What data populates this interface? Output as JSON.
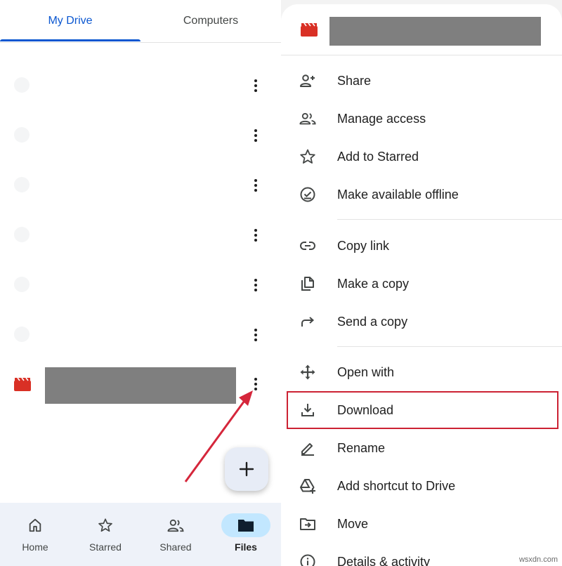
{
  "tabs": [
    {
      "label": "My Drive",
      "active": true
    },
    {
      "label": "Computers",
      "active": false
    }
  ],
  "file_list": {
    "highlighted_file_icon": "video-file-icon"
  },
  "bottom_nav": [
    {
      "label": "Home",
      "icon": "home-icon",
      "active": false
    },
    {
      "label": "Starred",
      "icon": "star-icon",
      "active": false
    },
    {
      "label": "Shared",
      "icon": "people-icon",
      "active": false
    },
    {
      "label": "Files",
      "icon": "folder-icon",
      "active": true
    }
  ],
  "fab": {
    "icon": "plus-icon"
  },
  "sheet": {
    "header_icon": "video-file-icon",
    "groups": [
      [
        {
          "label": "Share",
          "icon": "person-add-icon"
        },
        {
          "label": "Manage access",
          "icon": "people-icon"
        },
        {
          "label": "Add to Starred",
          "icon": "star-icon"
        },
        {
          "label": "Make available offline",
          "icon": "offline-check-icon"
        }
      ],
      [
        {
          "label": "Copy link",
          "icon": "link-icon"
        },
        {
          "label": "Make a copy",
          "icon": "copy-icon"
        },
        {
          "label": "Send a copy",
          "icon": "forward-icon"
        }
      ],
      [
        {
          "label": "Open with",
          "icon": "open-with-icon"
        },
        {
          "label": "Download",
          "icon": "download-icon",
          "highlighted": true
        },
        {
          "label": "Rename",
          "icon": "pencil-icon"
        },
        {
          "label": "Add shortcut to Drive",
          "icon": "drive-shortcut-icon"
        },
        {
          "label": "Move",
          "icon": "move-folder-icon"
        },
        {
          "label": "Details & activity",
          "icon": "info-icon"
        }
      ]
    ]
  },
  "colors": {
    "accent": "#0b57d0",
    "video_icon": "#d93025",
    "highlight_box": "#cc2233",
    "annotation_arrow": "#d5263b",
    "nav_active_pill": "#c2e7ff"
  },
  "watermark": "wsxdn.com"
}
